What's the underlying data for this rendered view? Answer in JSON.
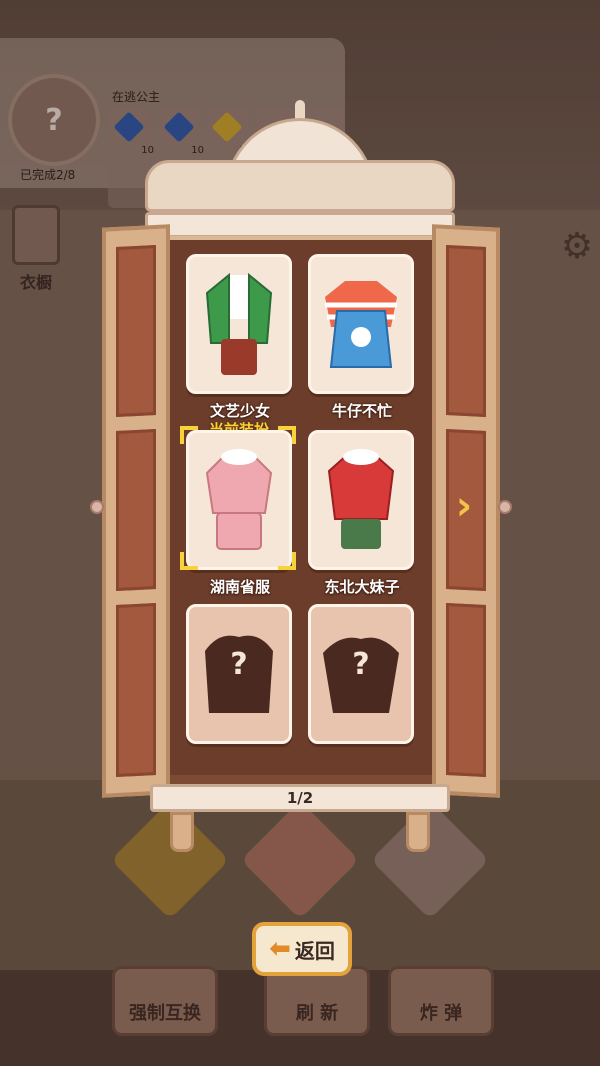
{
  "princess": {
    "title": "在逃公主",
    "completed": "已完成2/8",
    "portrait_symbol": "?",
    "slots": [
      {
        "gem_color": "#2a56a8",
        "count": "10"
      },
      {
        "gem_color": "#2a56a8",
        "count": "10"
      },
      {
        "gem_color": "#c9a22a",
        "count": "10"
      }
    ]
  },
  "sidebar": {
    "wardrobe_label": "衣橱"
  },
  "icons": {
    "settings": "gear-icon",
    "next": "chevron-right-icon",
    "back": "arrow-left-icon"
  },
  "wardrobe": {
    "page": "1/2",
    "current_tag": "当前装扮",
    "outfits": [
      {
        "name": "文艺少女",
        "locked": false
      },
      {
        "name": "牛仔不忙",
        "locked": false
      },
      {
        "name": "湖南省服",
        "locked": false,
        "current": true
      },
      {
        "name": "东北大妹子",
        "locked": false
      },
      {
        "name": "",
        "locked": true,
        "symbol": "?"
      },
      {
        "name": "",
        "locked": true,
        "symbol": "?"
      }
    ]
  },
  "toolbar": {
    "back_label": "返回",
    "swap_label": "强制互换",
    "refresh_label": "刷 新",
    "bomb_label": "炸 弹"
  },
  "colors": {
    "accent_gold": "#f7d23a",
    "wood": "#d8b08a",
    "wardrobe_inner": "#7d4a33"
  }
}
